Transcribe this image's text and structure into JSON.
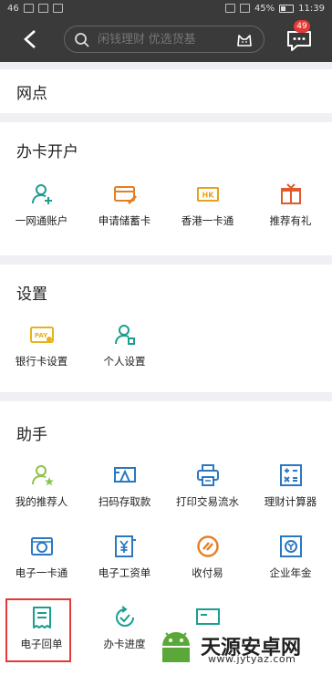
{
  "status": {
    "signal": "46",
    "battery": "45%",
    "time": "11:39"
  },
  "header": {
    "search_placeholder": "闲钱理财 优选货基",
    "message_badge": "49"
  },
  "sections": {
    "outlets": {
      "title": "网点"
    },
    "open_card": {
      "title": "办卡开户",
      "items": [
        {
          "label": "一网通账户",
          "icon": "user-add-icon",
          "color": "#1a9e8f"
        },
        {
          "label": "申请储蓄卡",
          "icon": "card-edit-icon",
          "color": "#e67e22"
        },
        {
          "label": "香港一卡通",
          "icon": "hk-card-icon",
          "color": "#e6a21e"
        },
        {
          "label": "推荐有礼",
          "icon": "gift-icon",
          "color": "#e05a2b"
        }
      ]
    },
    "settings": {
      "title": "设置",
      "items": [
        {
          "label": "银行卡设置",
          "icon": "pay-card-icon",
          "color": "#e6b21e"
        },
        {
          "label": "个人设置",
          "icon": "user-settings-icon",
          "color": "#1a9e8f"
        }
      ]
    },
    "assistant": {
      "title": "助手",
      "items": [
        {
          "label": "我的推荐人",
          "icon": "referrer-icon",
          "color": "#8bc34a"
        },
        {
          "label": "扫码存取款",
          "icon": "scan-cash-icon",
          "color": "#2b78c2"
        },
        {
          "label": "打印交易流水",
          "icon": "printer-icon",
          "color": "#2b78c2"
        },
        {
          "label": "理财计算器",
          "icon": "calculator-icon",
          "color": "#2b78c2"
        },
        {
          "label": "电子一卡通",
          "icon": "e-card-icon",
          "color": "#2b78c2"
        },
        {
          "label": "电子工资单",
          "icon": "payslip-icon",
          "color": "#2b78c2"
        },
        {
          "label": "收付易",
          "icon": "payment-icon",
          "color": "#e67e22"
        },
        {
          "label": "企业年金",
          "icon": "annuity-icon",
          "color": "#2b78c2"
        },
        {
          "label": "电子回单",
          "icon": "receipt-icon",
          "color": "#1a9e8f"
        },
        {
          "label": "办卡进度",
          "icon": "progress-icon",
          "color": "#1a9e8f"
        }
      ]
    }
  },
  "watermark": {
    "title": "天源安卓网",
    "url": "www.jytyaz.com"
  }
}
